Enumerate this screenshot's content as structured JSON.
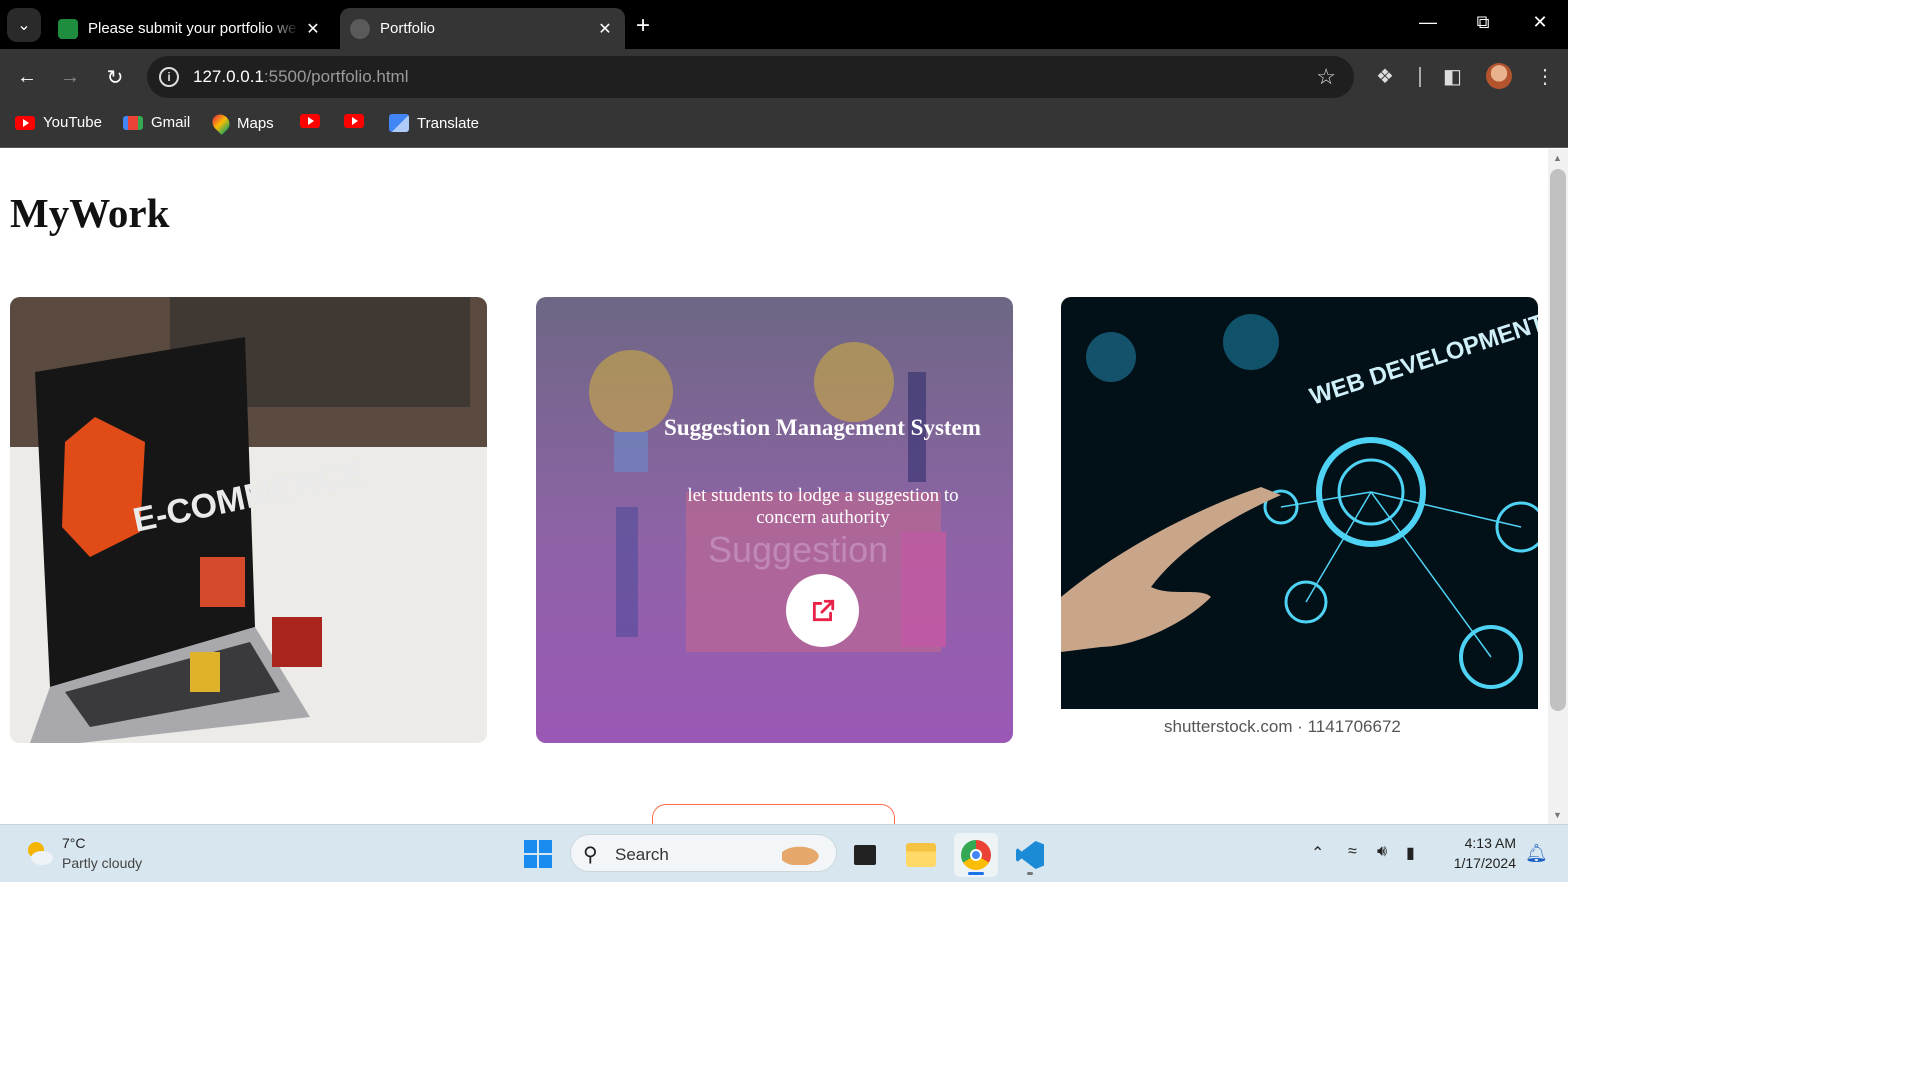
{
  "browser": {
    "tabs": [
      {
        "title": "Please submit your portfolio we",
        "active": false
      },
      {
        "title": "Portfolio",
        "active": true
      }
    ],
    "url_host": "127.0.0.1",
    "url_path": ":5500/portfolio.html",
    "bookmarks": [
      {
        "label": "YouTube",
        "icon": "youtube-icon"
      },
      {
        "label": "Gmail",
        "icon": "gmail-icon"
      },
      {
        "label": "Maps",
        "icon": "maps-icon"
      },
      {
        "label": "",
        "icon": "youtube-icon"
      },
      {
        "label": "",
        "icon": "youtube-icon"
      },
      {
        "label": "Translate",
        "icon": "translate-icon"
      }
    ]
  },
  "page": {
    "heading": "MyWork",
    "cards": [
      {
        "image": "ecommerce-laptop-image",
        "image_text": "E-COMMERCE"
      },
      {
        "image": "suggestion-box-image",
        "overlay_title": "Suggestion Management System",
        "overlay_text": "let students to lodge a suggestion to concern authority",
        "image_text": "Suggestion"
      },
      {
        "image": "web-development-image",
        "image_text": "WEB DEVELOPMENT",
        "watermark": "shutterstock.com · 1141706672"
      }
    ]
  },
  "taskbar": {
    "weather_temp": "7°C",
    "weather_desc": "Partly cloudy",
    "search_placeholder": "Search",
    "time": "4:13 AM",
    "date": "1/17/2024"
  },
  "colors": {
    "card_overlay_top": "#6d6784",
    "card_overlay_bottom": "#9b58b6",
    "accent_button_border": "#ff6a4a",
    "link_icon": "#e8234a"
  }
}
